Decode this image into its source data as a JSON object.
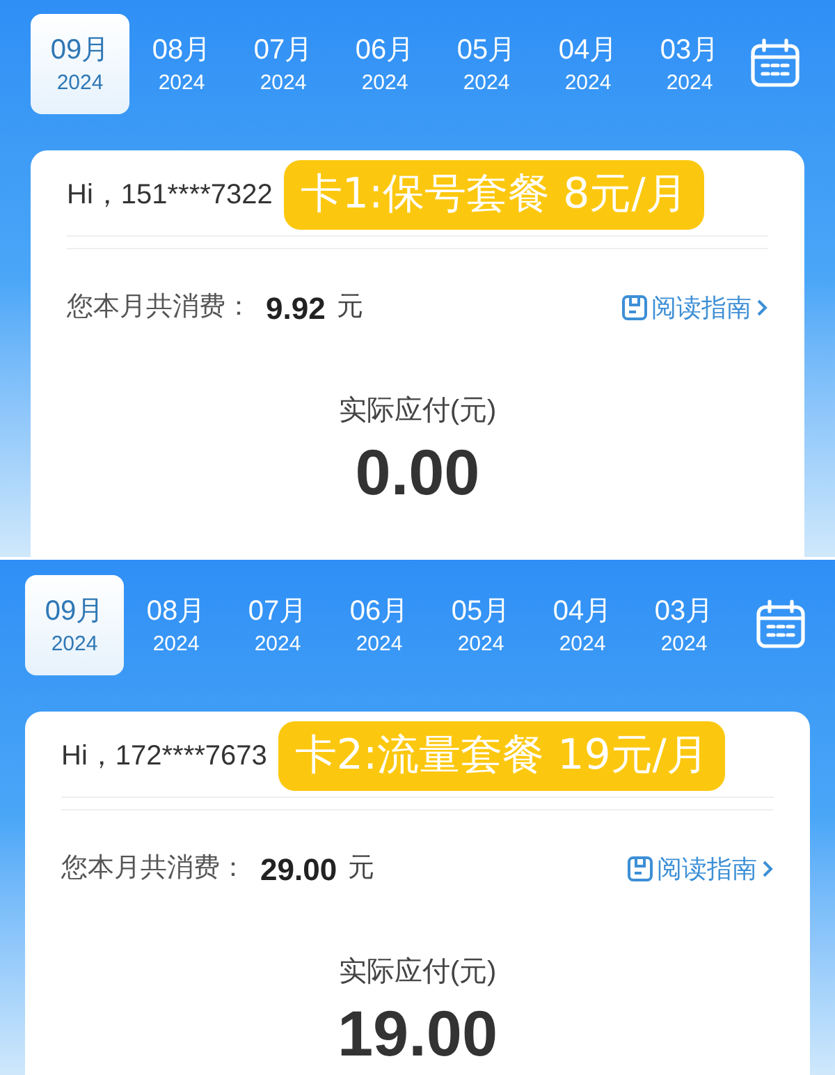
{
  "panels": [
    {
      "months": [
        {
          "month": "09月",
          "year": "2024",
          "selected": true
        },
        {
          "month": "08月",
          "year": "2024",
          "selected": false
        },
        {
          "month": "07月",
          "year": "2024",
          "selected": false
        },
        {
          "month": "06月",
          "year": "2024",
          "selected": false
        },
        {
          "month": "05月",
          "year": "2024",
          "selected": false
        },
        {
          "month": "04月",
          "year": "2024",
          "selected": false
        },
        {
          "month": "03月",
          "year": "2024",
          "selected": false
        }
      ],
      "greeting": "Hi，151****7322",
      "badge": "卡1:保号套餐 8元/月",
      "spend_label": "您本月共消费：",
      "spend_amount": "9.92",
      "spend_unit": "元",
      "guide_link": "阅读指南",
      "pay_label": "实际应付(元)",
      "pay_amount": "0.00"
    },
    {
      "months": [
        {
          "month": "09月",
          "year": "2024",
          "selected": true
        },
        {
          "month": "08月",
          "year": "2024",
          "selected": false
        },
        {
          "month": "07月",
          "year": "2024",
          "selected": false
        },
        {
          "month": "06月",
          "year": "2024",
          "selected": false
        },
        {
          "month": "05月",
          "year": "2024",
          "selected": false
        },
        {
          "month": "04月",
          "year": "2024",
          "selected": false
        },
        {
          "month": "03月",
          "year": "2024",
          "selected": false
        }
      ],
      "greeting": "Hi，172****7673",
      "badge": "卡2:流量套餐 19元/月",
      "spend_label": "您本月共消费：",
      "spend_amount": "29.00",
      "spend_unit": "元",
      "guide_link": "阅读指南",
      "pay_label": "实际应付(元)",
      "pay_amount": "19.00"
    }
  ]
}
